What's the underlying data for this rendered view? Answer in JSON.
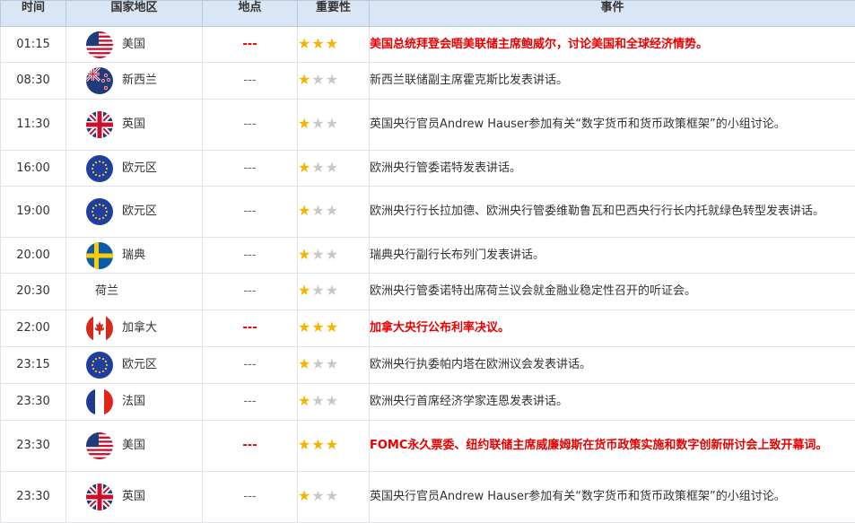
{
  "headers": {
    "time": "时间",
    "country": "国家地区",
    "place": "地点",
    "importance": "重要性",
    "event": "事件"
  },
  "colors": {
    "header_bg": "#dbe6f4",
    "important_text": "#e60000",
    "star_on": "#f5b400",
    "star_off": "#c8c8c8"
  },
  "rows": [
    {
      "time": "01:15",
      "flag": "us",
      "country": "美国",
      "place": "---",
      "stars": 3,
      "important": true,
      "event": "美国总统拜登会晤美联储主席鲍威尔，讨论美国和全球经济情势。"
    },
    {
      "time": "08:30",
      "flag": "nz",
      "country": "新西兰",
      "place": "---",
      "stars": 1,
      "important": false,
      "event": "新西兰联储副主席霍克斯比发表讲话。"
    },
    {
      "time": "11:30",
      "flag": "uk",
      "country": "英国",
      "place": "---",
      "stars": 1,
      "important": false,
      "event": "英国央行官员Andrew Hauser参加有关“数字货币和货币政策框架”的小组讨论。"
    },
    {
      "time": "16:00",
      "flag": "eu",
      "country": "欧元区",
      "place": "---",
      "stars": 1,
      "important": false,
      "event": "欧洲央行管委诺特发表讲话。"
    },
    {
      "time": "19:00",
      "flag": "eu",
      "country": "欧元区",
      "place": "---",
      "stars": 1,
      "important": false,
      "event": "欧洲央行行长拉加德、欧洲央行管委维勒鲁瓦和巴西央行行长内托就绿色转型发表讲话。"
    },
    {
      "time": "20:00",
      "flag": "se",
      "country": "瑞典",
      "place": "---",
      "stars": 1,
      "important": false,
      "event": "瑞典央行副行长布列门发表讲话。"
    },
    {
      "time": "20:30",
      "flag": "none",
      "country": "荷兰",
      "place": "---",
      "stars": 1,
      "important": false,
      "event": "欧洲央行管委诺特出席荷兰议会就金融业稳定性召开的听证会。"
    },
    {
      "time": "22:00",
      "flag": "ca",
      "country": "加拿大",
      "place": "---",
      "stars": 3,
      "important": true,
      "event": "加拿大央行公布利率决议。"
    },
    {
      "time": "23:15",
      "flag": "eu",
      "country": "欧元区",
      "place": "---",
      "stars": 1,
      "important": false,
      "event": "欧洲央行执委帕内塔在欧洲议会发表讲话。"
    },
    {
      "time": "23:30",
      "flag": "fr",
      "country": "法国",
      "place": "---",
      "stars": 1,
      "important": false,
      "event": "欧洲央行首席经济学家连恩发表讲话。"
    },
    {
      "time": "23:30",
      "flag": "us",
      "country": "美国",
      "place": "---",
      "stars": 3,
      "important": true,
      "event": "FOMC永久票委、纽约联储主席威廉姆斯在货币政策实施和数字创新研讨会上致开幕词。"
    },
    {
      "time": "23:30",
      "flag": "uk",
      "country": "英国",
      "place": "---",
      "stars": 1,
      "important": false,
      "event": "英国央行官员Andrew Hauser参加有关“数字货币和货币政策框架”的小组讨论。"
    }
  ]
}
